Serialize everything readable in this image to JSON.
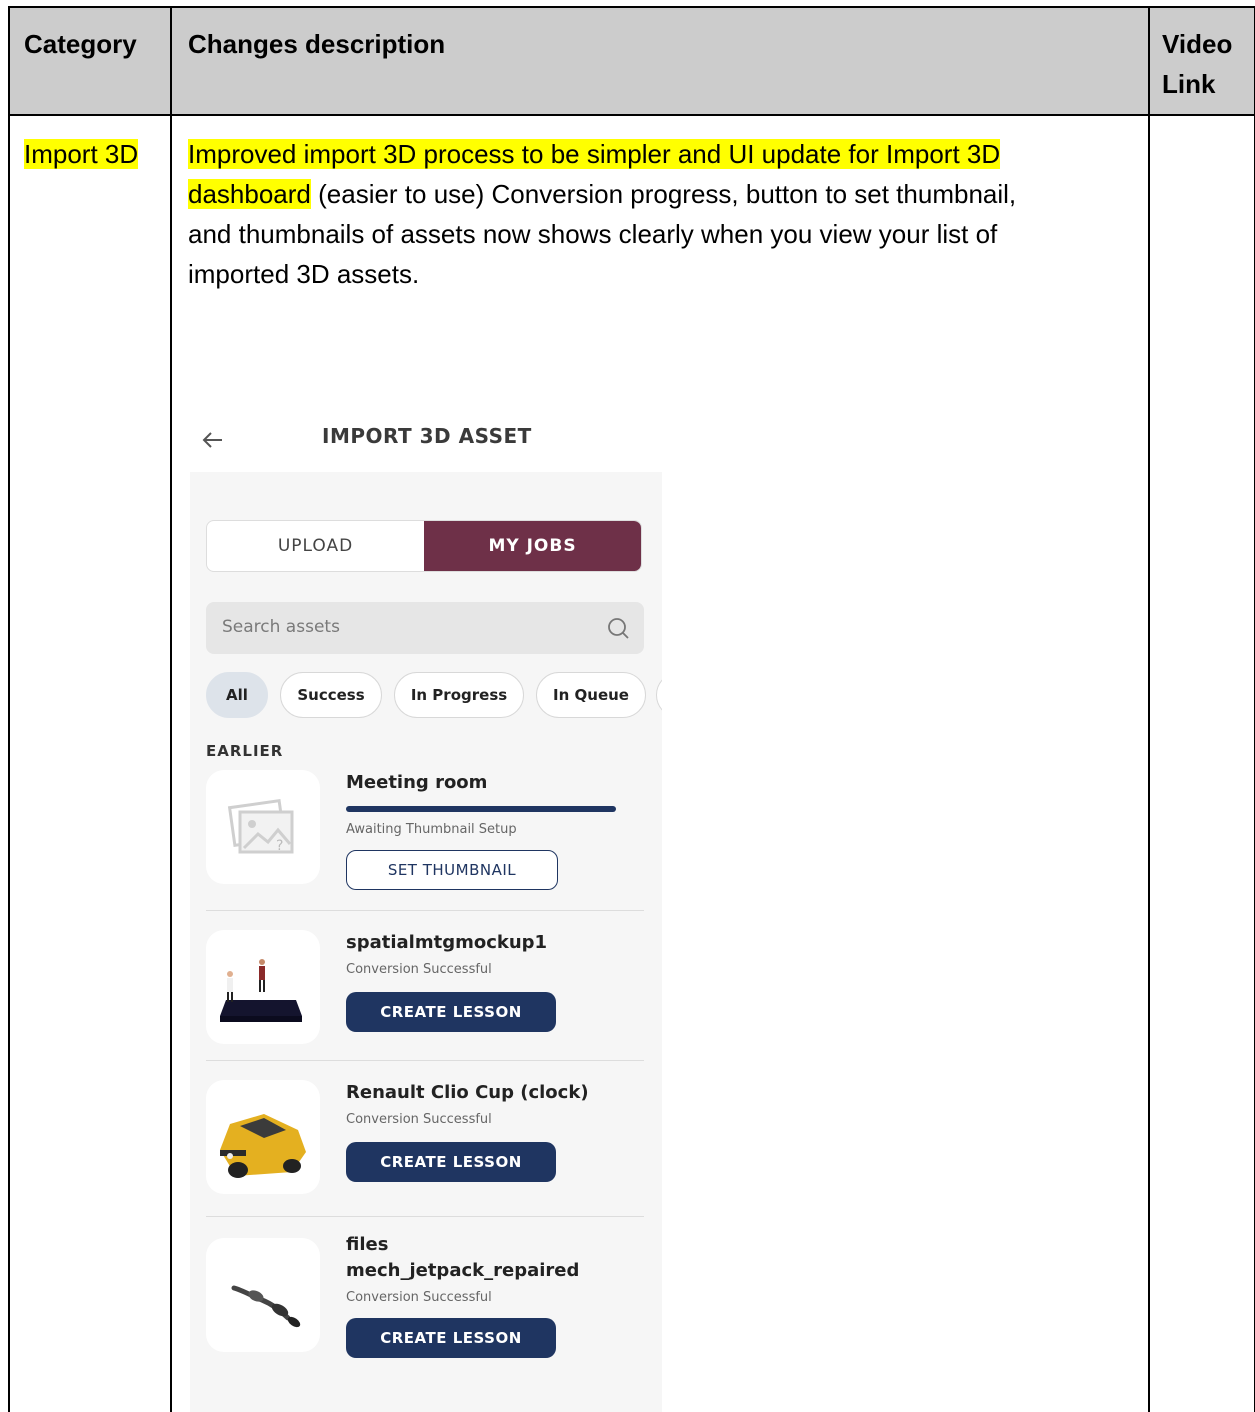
{
  "table": {
    "headers": {
      "category": "Category",
      "changes": "Changes description",
      "video_line1": "Video",
      "video_line2": "Link"
    },
    "row": {
      "category": "Import 3D",
      "desc_highlight_1": "Improved import 3D process to be simpler and UI update for Import 3D",
      "desc_highlight_2": "dashboard",
      "desc_rest_1": " (easier to use) Conversion progress, button to set thumbnail,",
      "desc_line3": "and thumbnails of assets now shows clearly when you view your list of",
      "desc_line4": "imported 3D assets."
    }
  },
  "app": {
    "title": "IMPORT 3D ASSET",
    "tabs": {
      "upload": "UPLOAD",
      "my_jobs": "MY JOBS",
      "active": "my_jobs"
    },
    "search": {
      "placeholder": "Search assets"
    },
    "filters": [
      "All",
      "Success",
      "In Progress",
      "In Queue"
    ],
    "active_filter": "All",
    "section_label": "EARLIER",
    "items": [
      {
        "name": "Meeting room",
        "status": "Awaiting Thumbnail Setup",
        "action": "SET THUMBNAIL",
        "progress": 1.0,
        "thumbnail": "placeholder-image-icon"
      },
      {
        "name": "spatialmtgmockup1",
        "status": "Conversion Successful",
        "action": "CREATE LESSON",
        "thumbnail": "meeting-platform-icon"
      },
      {
        "name": "Renault Clio Cup (clock)",
        "status": "Conversion Successful",
        "action": "CREATE LESSON",
        "thumbnail": "yellow-car-icon"
      },
      {
        "name_line1": "files",
        "name_line2": "mech_jetpack_repaired",
        "status": "Conversion Successful",
        "action": "CREATE LESSON",
        "thumbnail": "jetpack-icon"
      }
    ],
    "colors": {
      "tab_active": "#6e3048",
      "primary": "#1f3561",
      "highlight": "#ffff00"
    }
  }
}
